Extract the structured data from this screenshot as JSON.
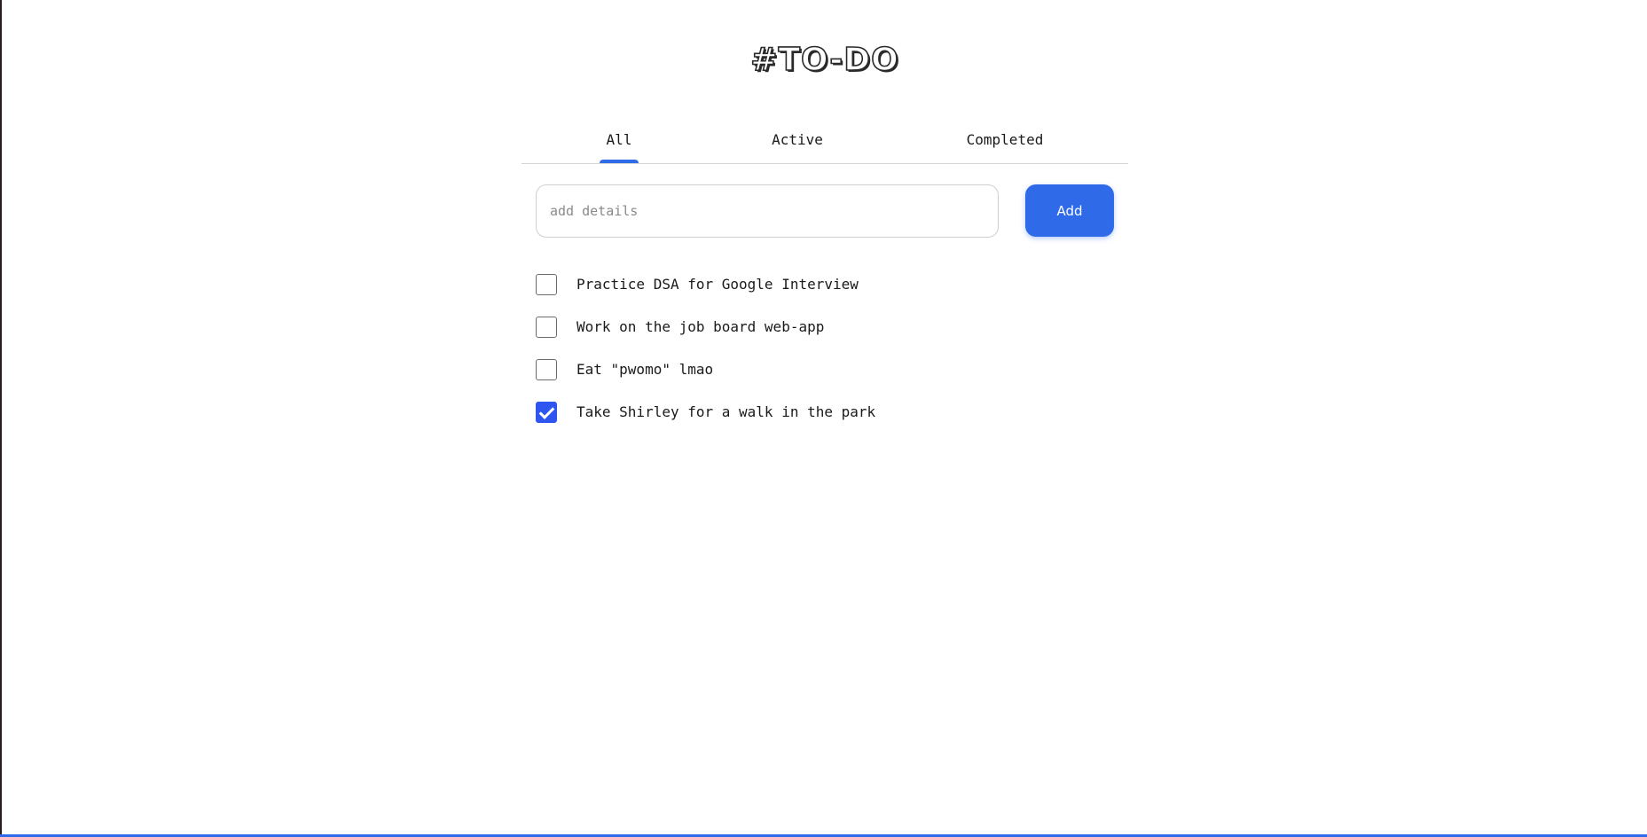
{
  "app": {
    "title": "#TO-DO"
  },
  "tabs": [
    {
      "label": "All",
      "selected": true
    },
    {
      "label": "Active",
      "selected": false
    },
    {
      "label": "Completed",
      "selected": false
    }
  ],
  "new_todo": {
    "value": "",
    "placeholder": "add details",
    "add_label": "Add"
  },
  "todos": [
    {
      "text": "Practice DSA for Google Interview",
      "completed": false
    },
    {
      "text": "Work on the job board web-app",
      "completed": false
    },
    {
      "text": "Eat \"pwomo\" lmao",
      "completed": false
    },
    {
      "text": "Take Shirley for a walk in the park",
      "completed": true
    }
  ],
  "colors": {
    "accent": "#2f6ae8",
    "checkbox_checked": "#2f55f0",
    "border": "#cfcfcf"
  }
}
